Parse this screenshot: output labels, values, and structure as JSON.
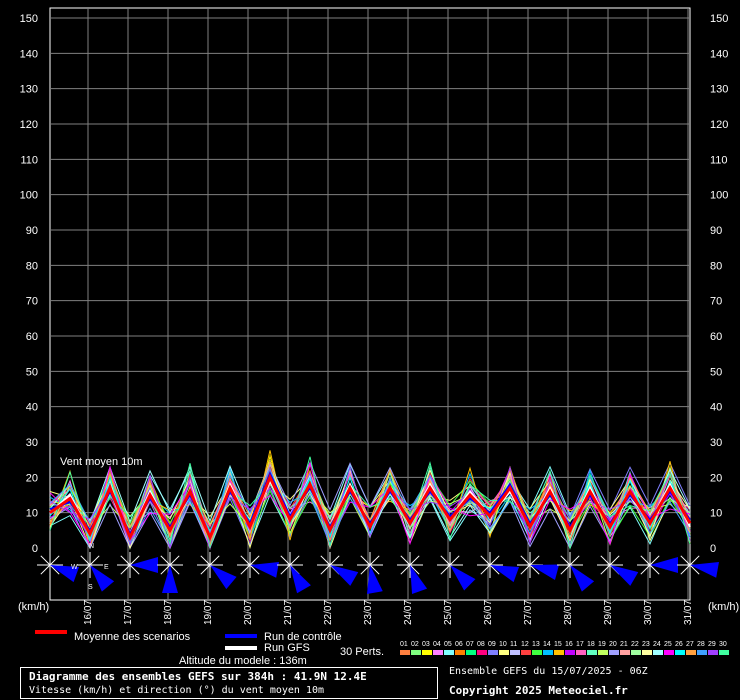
{
  "chart_data": {
    "type": "line",
    "title": "Diagramme des ensembles GEFS sur 384h : 41.9N 12.4E",
    "subtitle": "Vitesse (km/h) et direction (°) du vent moyen 10m",
    "annotation": "Vent moyen 10m",
    "altitude_label": "Altitude du modele : 136m",
    "ylabel": "(km/h)",
    "ylim": [
      0,
      150
    ],
    "yticks": [
      0,
      10,
      20,
      30,
      40,
      50,
      60,
      70,
      80,
      90,
      100,
      110,
      120,
      130,
      140,
      150
    ],
    "grid": true,
    "x_dates": [
      "16/07",
      "17/07",
      "18/07",
      "19/07",
      "20/07",
      "21/07",
      "22/07",
      "23/07",
      "24/07",
      "25/07",
      "26/07",
      "27/07",
      "28/07",
      "29/07",
      "30/07",
      "31/07"
    ],
    "x_hours_range": [
      0,
      384
    ],
    "legend": {
      "mean_label": "Moyenne des scenarios",
      "control_label": "Run de contrôle",
      "gfs_label": "Run GFS",
      "perts_label": "30 Perts.",
      "pert_numbers": [
        "01",
        "02",
        "03",
        "04",
        "05",
        "06",
        "07",
        "08",
        "09",
        "10",
        "11",
        "12",
        "13",
        "14",
        "15",
        "16",
        "17",
        "18",
        "19",
        "20",
        "21",
        "22",
        "23",
        "24",
        "25",
        "26",
        "27",
        "28",
        "29",
        "30"
      ]
    },
    "series": [
      {
        "name": "Moyenne des scenarios",
        "color": "#ff0000",
        "values": [
          10,
          14,
          4,
          17,
          3,
          15,
          5,
          16,
          3,
          17,
          6,
          20,
          8,
          18,
          5,
          17,
          6,
          17,
          7,
          17,
          8,
          15,
          9,
          17,
          6,
          16,
          5,
          16,
          6,
          16,
          7,
          17,
          7
        ]
      },
      {
        "name": "Run de contrôle",
        "color": "#0000ff",
        "values": [
          11,
          13,
          5,
          16,
          4,
          14,
          6,
          15,
          3,
          16,
          7,
          21,
          9,
          17,
          6,
          16,
          7,
          16,
          8,
          16,
          9,
          14,
          10,
          18,
          7,
          15,
          6,
          15,
          7,
          15,
          8,
          16,
          8
        ]
      },
      {
        "name": "Run GFS",
        "color": "#ffffff",
        "values": [
          10,
          15,
          4,
          16,
          3,
          16,
          5,
          15,
          3,
          18,
          6,
          19,
          8,
          17,
          5,
          18,
          6,
          16,
          7,
          18,
          8,
          16,
          9,
          16,
          6,
          17,
          5,
          17,
          6,
          15,
          7,
          18,
          6
        ]
      }
    ],
    "compass_labels": [
      "N",
      "W",
      "E",
      "S"
    ]
  },
  "colors": {
    "background": "#000000",
    "grid": "#808080",
    "mean": "#ff0000",
    "control": "#0000ff",
    "gfs": "#ffffff",
    "wind_arrow": "#0000ff",
    "pert_palette": [
      "#ff8040",
      "#80ff80",
      "#ffff00",
      "#ff80ff",
      "#80ffff",
      "#ff8000",
      "#00ff80",
      "#ff0080",
      "#8080ff",
      "#ffff80",
      "#c0c0ff",
      "#ff4040",
      "#40ff40",
      "#00c0ff",
      "#ffc000",
      "#c000ff",
      "#ff60c0",
      "#60ffc0",
      "#c0ff60",
      "#a0a0ff",
      "#ffa0a0",
      "#a0ffa0",
      "#ffffa0",
      "#a0ffff",
      "#ff00ff",
      "#00ffff",
      "#ffa040",
      "#40a0ff",
      "#a040ff",
      "#40ffa0"
    ]
  },
  "footer": {
    "run_text": "Ensemble GEFS du 15/07/2025 - 06Z",
    "copyright": "Copyright 2025 Meteociel.fr"
  }
}
